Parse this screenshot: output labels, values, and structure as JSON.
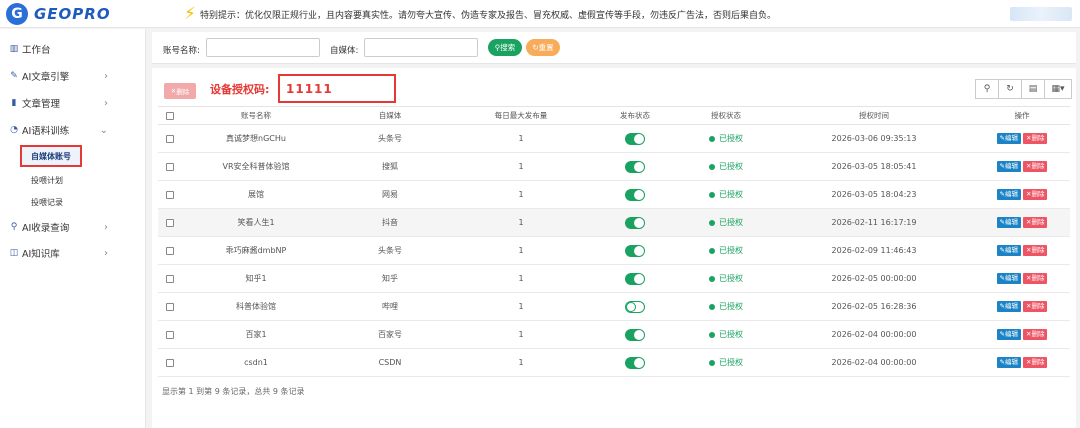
{
  "app": {
    "logo_letter": "G",
    "logo_text": "GEOPRO"
  },
  "notice": {
    "text": "特别提示：优化仅限正规行业，且内容要真实性。请勿夸大宣传、伪造专家及报告、冒充权威、虚假宣传等手段，勿违反广告法，否则后果自负。"
  },
  "sidebar": {
    "items": [
      {
        "label": "工作台",
        "icon": "bar-chart-icon"
      },
      {
        "label": "AI文章引擎",
        "icon": "pencil-icon"
      },
      {
        "label": "文章管理",
        "icon": "book-icon"
      },
      {
        "label": "AI语料训练",
        "icon": "signal-icon"
      },
      {
        "label": "AI收录查询",
        "icon": "search-icon"
      },
      {
        "label": "AI知识库",
        "icon": "columns-icon"
      }
    ],
    "sub_items": [
      "自媒体账号",
      "投喂计划",
      "投喂记录"
    ]
  },
  "search": {
    "account_label": "账号名称:",
    "media_label": "自媒体:",
    "search_btn": "搜索",
    "reset_btn": "重置"
  },
  "toolbar": {
    "delete_btn": "删除",
    "auth_label": "设备授权码:",
    "auth_code": "11111"
  },
  "table": {
    "headers": [
      "账号名称",
      "自媒体",
      "每日最大发布量",
      "发布状态",
      "授权状态",
      "授权时间",
      "操作"
    ],
    "edit_label": "编辑",
    "delete_label": "删除",
    "rows": [
      {
        "name": "真诚梦想nGCHu",
        "media": "头条号",
        "max": "1",
        "published": true,
        "auth": "已授权",
        "time": "2026-03-06 09:35:13"
      },
      {
        "name": "VR安全科普体验馆",
        "media": "搜狐",
        "max": "1",
        "published": true,
        "auth": "已授权",
        "time": "2026-03-05 18:05:41"
      },
      {
        "name": "展馆",
        "media": "网易",
        "max": "1",
        "published": true,
        "auth": "已授权",
        "time": "2026-03-05 18:04:23"
      },
      {
        "name": "笑看人生1",
        "media": "抖音",
        "max": "1",
        "published": true,
        "auth": "已授权",
        "time": "2026-02-11 16:17:19"
      },
      {
        "name": "乖巧麻酱dmbNP",
        "media": "头条号",
        "max": "1",
        "published": true,
        "auth": "已授权",
        "time": "2026-02-09 11:46:43"
      },
      {
        "name": "知乎1",
        "media": "知乎",
        "max": "1",
        "published": true,
        "auth": "已授权",
        "time": "2026-02-05 00:00:00"
      },
      {
        "name": "科普体验馆",
        "media": "哔哩",
        "max": "1",
        "published": false,
        "auth": "已授权",
        "time": "2026-02-05 16:28:36"
      },
      {
        "name": "百家1",
        "media": "百家号",
        "max": "1",
        "published": true,
        "auth": "已授权",
        "time": "2026-02-04 00:00:00"
      },
      {
        "name": "csdn1",
        "media": "CSDN",
        "max": "1",
        "published": true,
        "auth": "已授权",
        "time": "2026-02-04 00:00:00"
      }
    ]
  },
  "footer": {
    "text": "显示第 1 到第 9 条记录，总共 9 条记录"
  }
}
